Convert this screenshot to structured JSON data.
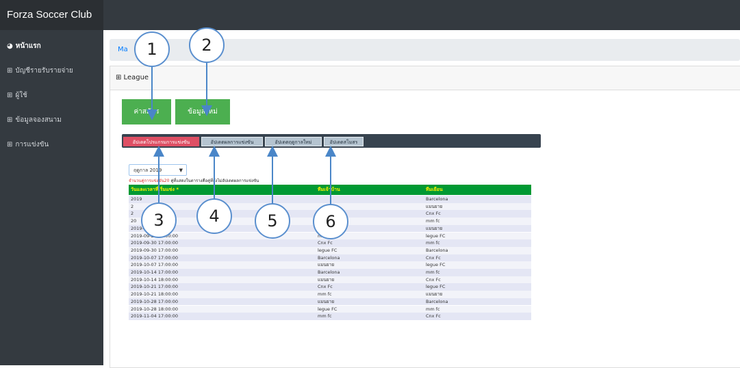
{
  "brand": {
    "title": "Forza Soccer Club",
    "menu_icon": "≡"
  },
  "sidebar": {
    "items": [
      {
        "label": "หน้าแรก",
        "icon": "dashboard-icon",
        "glyph": "◕"
      },
      {
        "label": "บัญชีรายรับรายจ่าย",
        "icon": "table-icon",
        "glyph": "⊞"
      },
      {
        "label": "ผู้ใช้",
        "icon": "table-icon",
        "glyph": "⊞"
      },
      {
        "label": "ข้อมูลจองสนาม",
        "icon": "table-icon",
        "glyph": "⊞"
      },
      {
        "label": "การแข่งขัน",
        "icon": "table-icon",
        "glyph": "⊞"
      }
    ]
  },
  "breadcrumb": {
    "text": "Ma"
  },
  "card": {
    "header": "⊞ League"
  },
  "buttons": {
    "fee": "ค่าสมัคร",
    "new_data": "ข้อมูลใหม่"
  },
  "tabs": [
    {
      "label": "อัปเดตโปรแกรมการแข่งขัน",
      "active": true
    },
    {
      "label": "อัปเดตผลการแข่งขัน",
      "active": false
    },
    {
      "label": "อัปเดตฤดูกาลใหม่",
      "active": false
    },
    {
      "label": "อัปเดตสโมสร",
      "active": false
    }
  ],
  "season_select": {
    "value": "ฤดูกาล 2019",
    "arrow": "▼"
  },
  "note": {
    "red": "จำนวนคู่การแข่งขัน20",
    "rest": " คู่ที่แสดงในตารางคือคู่ที่ยังไม่อัปเดตผลการแข่งขัน"
  },
  "table": {
    "headers": [
      "วันและเวลาที่เริ่มแข่ง *",
      "ทีมเจ้าบ้าน",
      "ทีมเยือน"
    ],
    "rows": [
      [
        "2019",
        "",
        "Barcelona"
      ],
      [
        "2",
        "",
        "แมนยาย"
      ],
      [
        "2",
        "",
        "Cnx Fc"
      ],
      [
        "20",
        "",
        "mm fc"
      ],
      [
        "2019-0…:00:00",
        "",
        "แมนยาย"
      ],
      [
        "2019-09-23 18:00:00",
        "mm fc",
        "legue FC"
      ],
      [
        "2019-09-30 17:00:00",
        "Cnx Fc",
        "mm fc"
      ],
      [
        "2019-09-30 17:00:00",
        "legue FC",
        "Barcelona"
      ],
      [
        "2019-10-07 17:00:00",
        "Barcelona",
        "Cnx Fc"
      ],
      [
        "2019-10-07 17:00:00",
        "แมนยาย",
        "legue FC"
      ],
      [
        "2019-10-14 17:00:00",
        "Barcelona",
        "mm fc"
      ],
      [
        "2019-10-14 18:00:00",
        "แมนยาย",
        "Cnx Fc"
      ],
      [
        "2019-10-21 17:00:00",
        "Cnx Fc",
        "legue FC"
      ],
      [
        "2019-10-21 18:00:00",
        "mm fc",
        "แมนยาย"
      ],
      [
        "2019-10-28 17:00:00",
        "แมนยาย",
        "Barcelona"
      ],
      [
        "2019-10-28 18:00:00",
        "legue FC",
        "mm fc"
      ],
      [
        "2019-11-04 17:00:00",
        "mm fc",
        "Cnx Fc"
      ]
    ]
  },
  "callouts": [
    "1",
    "2",
    "3",
    "4",
    "5",
    "6"
  ]
}
